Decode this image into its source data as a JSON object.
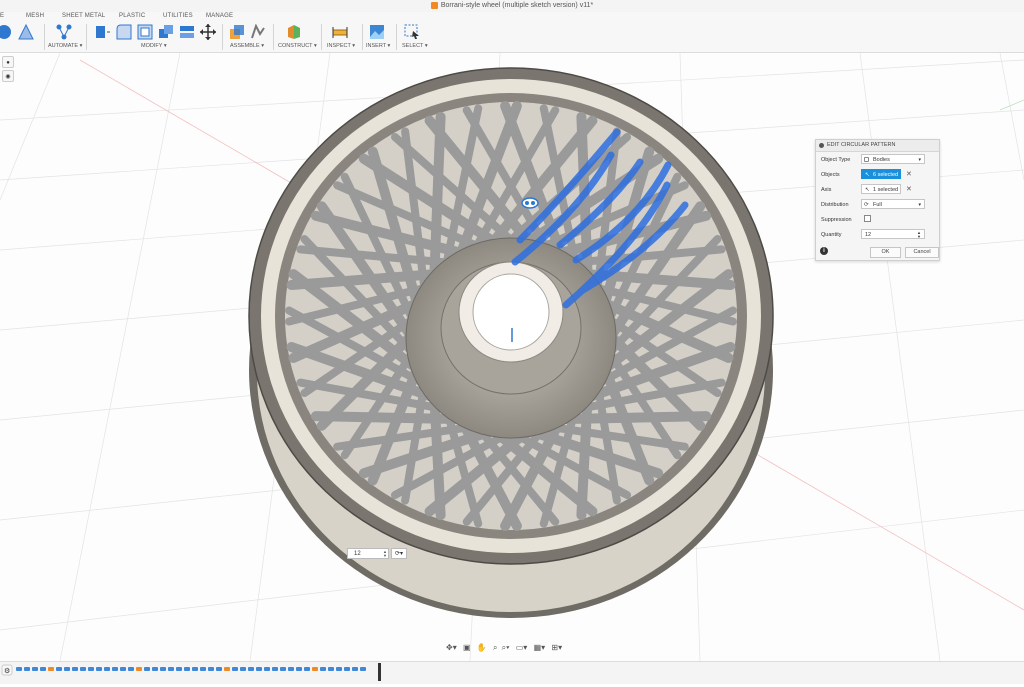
{
  "window": {
    "title": "Borrani-style wheel (multiple sketch version) v11*"
  },
  "toolbar": {
    "tabs": [
      {
        "id": "solid",
        "label": "E"
      },
      {
        "id": "mesh",
        "label": "MESH"
      },
      {
        "id": "sheetmetal",
        "label": "SHEET METAL"
      },
      {
        "id": "plastic",
        "label": "PLASTIC"
      },
      {
        "id": "utilities",
        "label": "UTILITIES"
      },
      {
        "id": "manage",
        "label": "MANAGE"
      }
    ],
    "groups": {
      "automate": "AUTOMATE",
      "modify": "MODIFY",
      "assemble": "ASSEMBLE",
      "construct": "CONSTRUCT",
      "inspect": "INSPECT",
      "insert": "INSERT",
      "select": "SELECT"
    },
    "dropdown_glyph": "▾"
  },
  "panel": {
    "title": "EDIT CIRCULAR PATTERN",
    "rows": {
      "object_type": {
        "label": "Object Type",
        "value": "Bodies"
      },
      "objects": {
        "label": "Objects",
        "value": "6 selected"
      },
      "axis": {
        "label": "Axis",
        "value": "1 selected"
      },
      "distribution": {
        "label": "Distribution",
        "value": "Full"
      },
      "suppression": {
        "label": "Suppression"
      },
      "quantity": {
        "label": "Quantity",
        "value": "12"
      }
    },
    "ok_label": "OK",
    "cancel_label": "Cancel",
    "info_glyph": "i",
    "clear_glyph": "✕"
  },
  "viewport": {
    "quantity_input": "12",
    "colors": {
      "wheel": "#8f8b84",
      "spoke": "#9a9a9a",
      "selected": "#2f6fe0",
      "grid": "#dedede"
    }
  },
  "colors": {
    "accent": "#1a8fdc"
  }
}
